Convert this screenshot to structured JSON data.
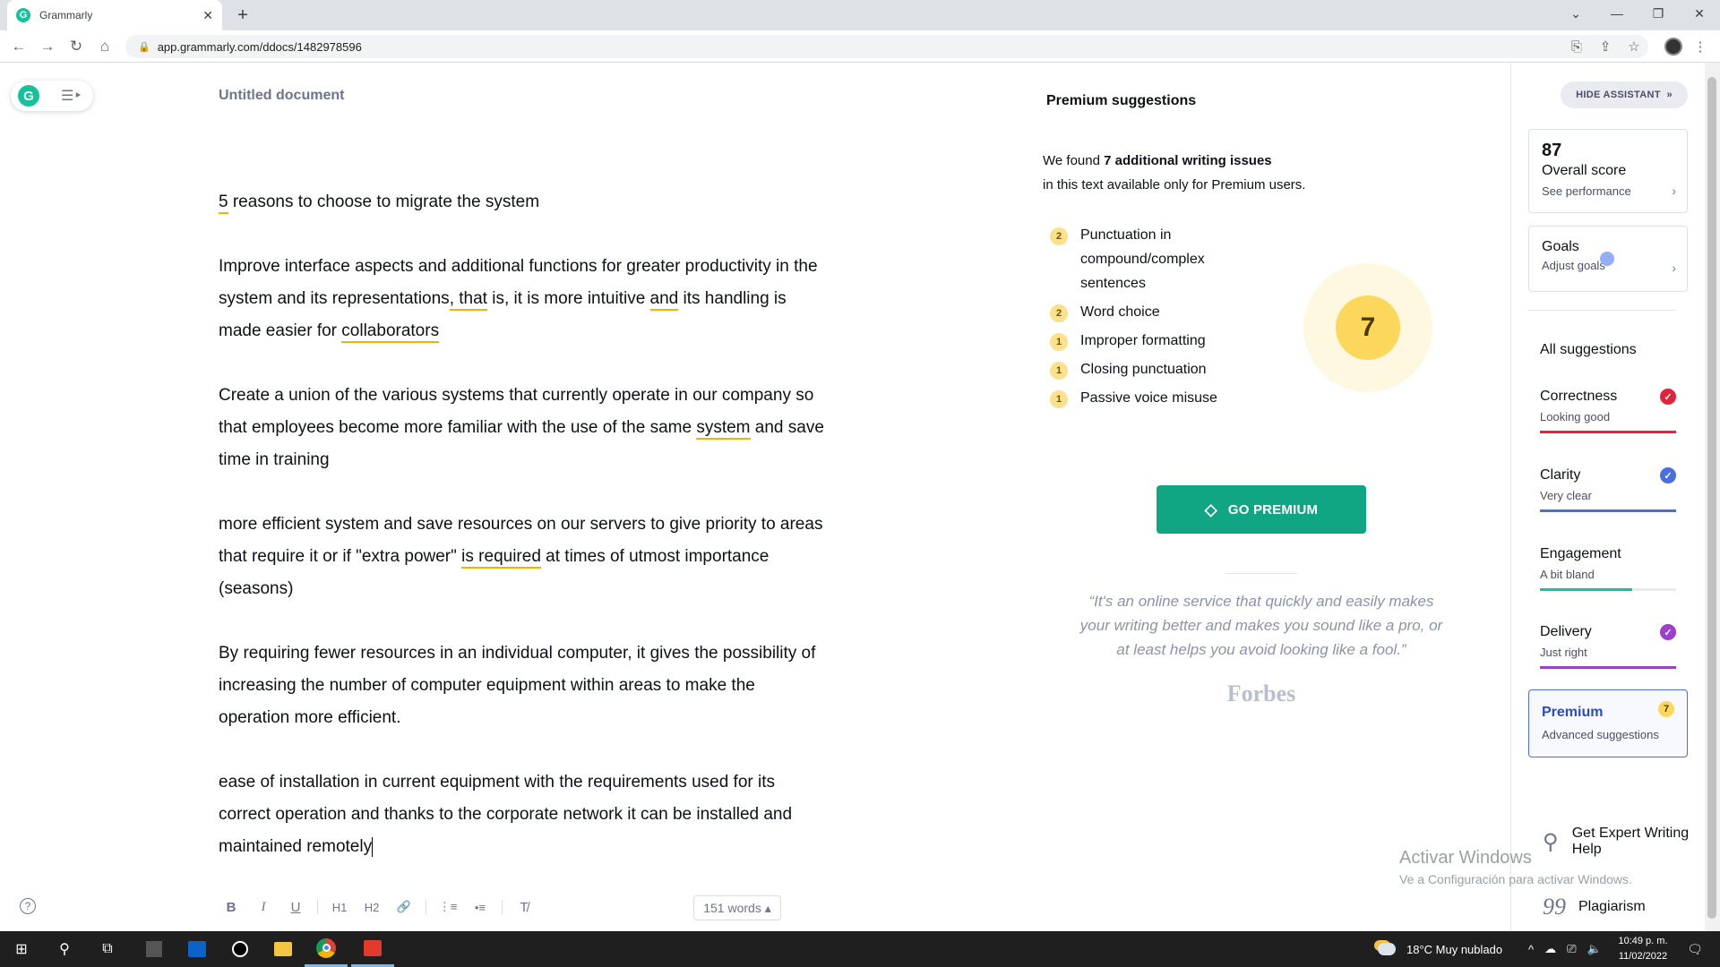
{
  "browser": {
    "tab_title": "Grammarly",
    "tab_favicon": "G",
    "tab_close": "✕",
    "new_tab": "+",
    "url": "app.grammarly.com/ddocs/1482978596"
  },
  "app": {
    "logo_letter": "G",
    "document_title": "Untitled document",
    "help": "?"
  },
  "document": {
    "title_line": {
      "before": "",
      "u1": "5",
      "after": " reasons to choose to migrate the system"
    },
    "p1": {
      "a": "Improve interface aspects and additional functions for greater productivity in the system and its representations",
      "u1": ", that",
      "b": " is, it is more intuitive ",
      "u2": "and",
      "c": " its handling is made easier for ",
      "u3": "collaborators",
      "d": ""
    },
    "p2": {
      "a": "Create a union of the various systems that currently operate in our company so that employees become more familiar with the use of the same ",
      "u1": "system",
      "b": " and save time in training"
    },
    "p3": {
      "a": "more efficient system and save resources on our servers to give priority to areas that require it or if \"extra power\" ",
      "u1": "is required",
      "b": " at times of utmost importance (seasons)"
    },
    "p4": "By requiring fewer resources in an individual computer, it gives the possibility of increasing the number of computer equipment within areas to make the operation more efficient.",
    "p5": "ease of installation in current equipment with the requirements used for its correct operation and thanks to the corporate network it can be installed and maintained remotely"
  },
  "format_toolbar": {
    "bold": "B",
    "italic": "I",
    "underline": "U",
    "h1": "H1",
    "h2": "H2",
    "link": "🔗",
    "ordered_list": "⋮≡",
    "bullet_list": "•≡",
    "clear": "T̸",
    "word_count": "151 words ▴"
  },
  "premium_panel": {
    "heading": "Premium suggestions",
    "intro_prefix": "We found ",
    "intro_bold": "7 additional writing issues",
    "intro_suffix": "in this text available only for Premium users.",
    "issues": [
      {
        "count": "2",
        "label": "Punctuation in compound/complex sentences"
      },
      {
        "count": "2",
        "label": "Word choice"
      },
      {
        "count": "1",
        "label": "Improper formatting"
      },
      {
        "count": "1",
        "label": "Closing punctuation"
      },
      {
        "count": "1",
        "label": "Passive voice misuse"
      }
    ],
    "total_badge": "7",
    "cta": "GO PREMIUM",
    "quote": "“It's an online service that quickly and easily makes your writing better and makes you sound like a pro, or at least helps you avoid looking like a fool.”",
    "quote_source": "Forbes"
  },
  "assistant": {
    "hide_label": "HIDE ASSISTANT",
    "score": "87",
    "score_label": "Overall score",
    "score_link": "See performance",
    "goals_label": "Goals",
    "goals_link": "Adjust goals",
    "all_suggestions": "All suggestions",
    "categories": [
      {
        "name": "Correctness",
        "status": "Looking good",
        "color": "#e0243c",
        "fill": 1.0,
        "checked": true
      },
      {
        "name": "Clarity",
        "status": "Very clear",
        "color": "#4a6ee0",
        "fill": 1.0,
        "checked": true
      },
      {
        "name": "Engagement",
        "status": "A bit bland",
        "color": "#15c39a",
        "fill": 0.68,
        "checked": false
      },
      {
        "name": "Delivery",
        "status": "Just right",
        "color": "#9d3ed0",
        "fill": 1.0,
        "checked": true
      }
    ],
    "premium_label": "Premium",
    "premium_sub": "Advanced suggestions",
    "premium_count": "7",
    "expert_help": "Get Expert Writing Help",
    "plagiarism": "Plagiarism",
    "plagiarism_icon": "99"
  },
  "windows_watermark": {
    "title": "Activar Windows",
    "subtitle": "Ve a Configuración para activar Windows."
  },
  "taskbar": {
    "weather": "18°C  Muy nublado",
    "time": "10:49 p. m.",
    "date": "11/02/2022"
  },
  "colors": {
    "grammarly_green": "#15c39a",
    "premium_button": "#11a683",
    "underline_premium": "#f2b300",
    "premium_blue": "#4a6ee0"
  }
}
